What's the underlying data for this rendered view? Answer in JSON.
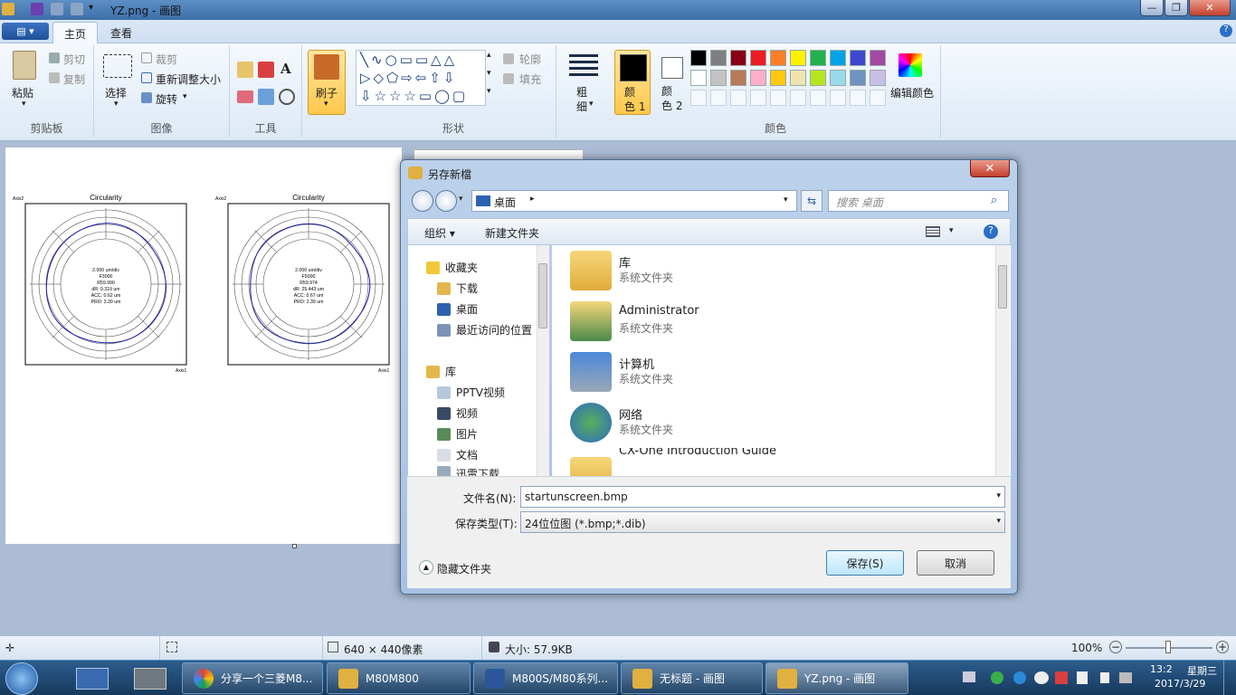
{
  "window": {
    "title": "YZ.png - 画图"
  },
  "tabs": {
    "file": "▤ ▾",
    "home": "主页",
    "view": "查看"
  },
  "ribbon": {
    "clipboard": {
      "label": "剪贴板",
      "paste": "粘贴",
      "cut": "剪切",
      "copy": "复制"
    },
    "image": {
      "label": "图像",
      "select": "选择",
      "crop": "裁剪",
      "resize": "重新调整大小",
      "rotate": "旋转"
    },
    "tools": {
      "label": "工具"
    },
    "brush": {
      "label": "刷子"
    },
    "shapes": {
      "label": "形状",
      "outline": "轮廓",
      "fill": "填充"
    },
    "size": {
      "label": "粗\n细"
    },
    "colors": {
      "label": "颜色",
      "color1": "颜\n色 1",
      "color2": "颜\n色 2",
      "edit": "编辑颜色",
      "palette_row1": [
        "#000000",
        "#7f7f7f",
        "#880015",
        "#ed1c24",
        "#ff7f27",
        "#fff200",
        "#22b14c",
        "#00a2e8",
        "#3f48cc",
        "#a349a4"
      ],
      "palette_row2": [
        "#ffffff",
        "#c3c3c3",
        "#b97a57",
        "#ffaec9",
        "#ffc90e",
        "#efe4b0",
        "#b5e61d",
        "#99d9ea",
        "#7092be",
        "#c8bfe7"
      ]
    }
  },
  "charts": [
    {
      "title": "Circularity",
      "axis2": "Axis2",
      "axis1": "Axis1",
      "lines": [
        "2.000 um/div",
        "F3000",
        "R59.990",
        "dR: 9.319 um",
        "ACC: 0.62 um",
        "PRO: 3.39 um"
      ]
    },
    {
      "title": "Circularity",
      "axis2": "Axis2",
      "axis1": "Axis1",
      "lines": [
        "2.000 um/div",
        "F5000",
        "R59.974",
        "dR: 25.443 um",
        "ACC: 0.67 um",
        "PRO: 2.39 um"
      ]
    }
  ],
  "dialog": {
    "title": "另存新檔",
    "address": "桌面",
    "search_placeholder": "搜索 桌面",
    "toolbar": {
      "organize": "组织 ▾",
      "new_folder": "新建文件夹"
    },
    "nav": {
      "favorites": "收藏夹",
      "downloads": "下载",
      "desktop": "桌面",
      "recent": "最近访问的位置",
      "library": "库",
      "pptv": "PPTV视频",
      "video": "视频",
      "pictures": "图片",
      "docs": "文档",
      "thunder": "迅雷下载"
    },
    "files": [
      {
        "name": "库",
        "sub": "系统文件夹"
      },
      {
        "name": "Administrator",
        "sub": "系统文件夹"
      },
      {
        "name": "计算机",
        "sub": "系统文件夹"
      },
      {
        "name": "网络",
        "sub": "系统文件夹"
      },
      {
        "name": "CX-One Introduction Guide",
        "sub": ""
      }
    ],
    "filename_label": "文件名(N):",
    "filename": "startunscreen.bmp",
    "type_label": "保存类型(T):",
    "type": "24位位图 (*.bmp;*.dib)",
    "hide_folders": "隐藏文件夹",
    "save": "保存(S)",
    "cancel": "取消"
  },
  "status": {
    "dimensions": "640 × 440像素",
    "size": "大小: 57.9KB",
    "zoom": "100%"
  },
  "taskbar": {
    "items": [
      "分享一个三菱M8...",
      "M80M800",
      "M800S/M80系列...",
      "无标题 - 画图",
      "YZ.png - 画图"
    ],
    "clock_time": "13:2",
    "clock_day": "星期三",
    "clock_date": "2017/3/29"
  }
}
